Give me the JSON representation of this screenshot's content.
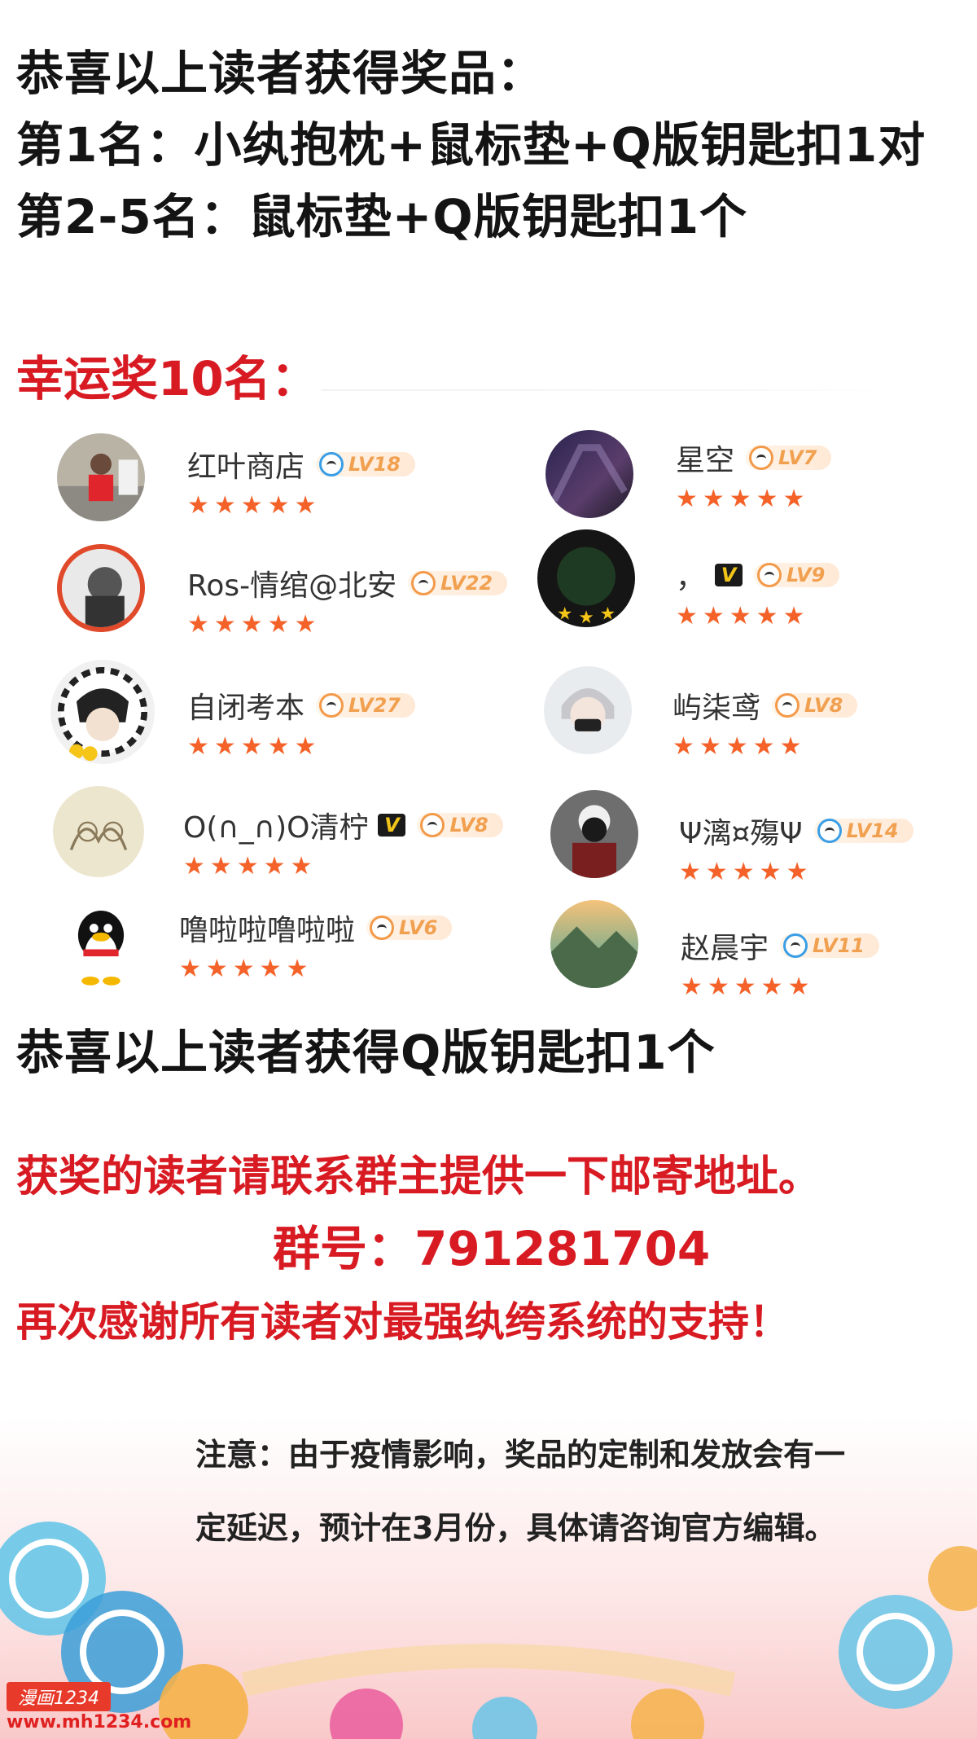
{
  "top": {
    "line1": "恭喜以上读者获得奖品：",
    "line2": "第1名：小纨抱枕+鼠标垫+Q版钥匙扣1对",
    "line3": "第2-5名：鼠标垫+Q版钥匙扣1个"
  },
  "lucky": {
    "title": "幸运奖10名："
  },
  "winners": [
    {
      "name": "红叶商店",
      "level": "LV18",
      "stars": "★★★★★",
      "vip": ""
    },
    {
      "name": "星空",
      "level": "LV7",
      "stars": "★★★★★",
      "vip": ""
    },
    {
      "name": "Ros-情绾@北安",
      "level": "LV22",
      "stars": "★★★★★",
      "vip": ""
    },
    {
      "name": "，",
      "level": "LV9",
      "stars": "★★★★★",
      "vip": "V"
    },
    {
      "name": "自闭考本",
      "level": "LV27",
      "stars": "★★★★★",
      "vip": ""
    },
    {
      "name": "屿柒鸢",
      "level": "LV8",
      "stars": "★★★★★",
      "vip": ""
    },
    {
      "name": "O(∩_∩)O清柠",
      "level": "LV8",
      "stars": "★★★★★",
      "vip": "V"
    },
    {
      "name": "Ψ漓¤殤Ψ",
      "level": "LV14",
      "stars": "★★★★★",
      "vip": ""
    },
    {
      "name": "噜啦啦噜啦啦",
      "level": "LV6",
      "stars": "★★★★★",
      "vip": ""
    },
    {
      "name": "赵晨宇",
      "level": "LV11",
      "stars": "★★★★★",
      "vip": ""
    }
  ],
  "keychain_line": "恭喜以上读者获得Q版钥匙扣1个",
  "contact": {
    "line1": "获奖的读者请联系群主提供一下邮寄地址。",
    "line2": "群号：791281704",
    "line3": "再次感谢所有读者对最强纨绔系统的支持！"
  },
  "notice": {
    "line1": "注意：由于疫情影响，奖品的定制和发放会有一",
    "line2": "定延迟，预计在3月份，具体请咨询官方编辑。"
  },
  "watermark": {
    "logo": "漫画1234",
    "url": "www.mh1234.com"
  },
  "colors": {
    "red": "#d81b23",
    "star": "#f4622a",
    "level": "#f1a050"
  }
}
